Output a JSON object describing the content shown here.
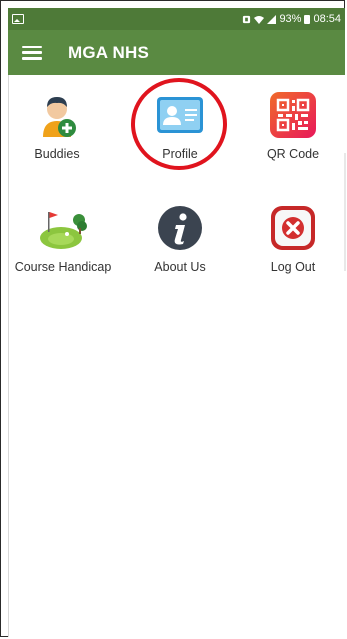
{
  "status_bar": {
    "battery": "93%",
    "time": "08:54"
  },
  "app_bar": {
    "title": "MGA NHS",
    "menu_icon": "hamburger-menu-icon"
  },
  "tiles": [
    {
      "label": "Buddies",
      "icon": "add-buddy-icon"
    },
    {
      "label": "Profile",
      "icon": "profile-card-icon"
    },
    {
      "label": "QR Code",
      "icon": "qr-code-icon"
    },
    {
      "label": "Course Handicap",
      "icon": "golf-course-icon"
    },
    {
      "label": "About Us",
      "icon": "info-icon"
    },
    {
      "label": "Log Out",
      "icon": "logout-icon"
    }
  ],
  "colors": {
    "status_bar": "#4e7a38",
    "app_bar": "#5a8a42",
    "highlight": "#e0141e"
  }
}
